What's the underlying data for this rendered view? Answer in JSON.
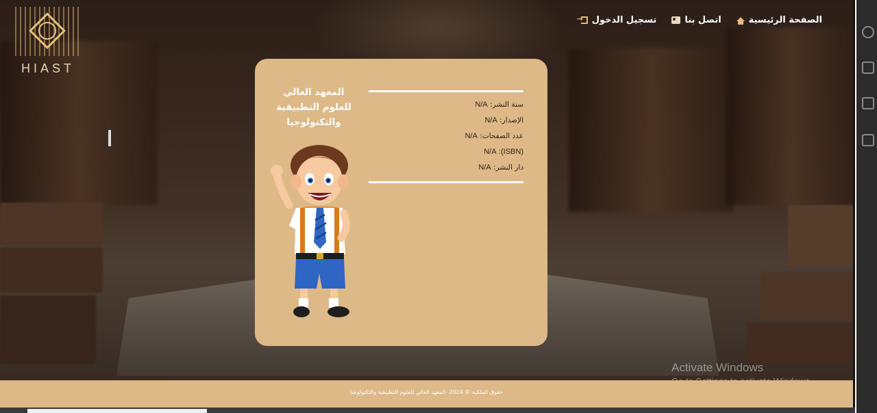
{
  "logo": {
    "text": "HIAST"
  },
  "nav": {
    "login": "تسجيل الدخول",
    "contact": "اتصل بنا",
    "home": "الصفحة الرئيسية"
  },
  "card": {
    "institute_name": "المعهد العالي للعلوم التطبيقية والتكنولوجيا",
    "details": [
      {
        "label": "سنة النشر:",
        "value": "N/A"
      },
      {
        "label": "الإصدار:",
        "value": "N/A"
      },
      {
        "label": "عدد الصفحات:",
        "value": "N/A"
      },
      {
        "label": "(ISBN):",
        "value": "N/A"
      },
      {
        "label": "دار النشر:",
        "value": "N/A"
      }
    ]
  },
  "footer": {
    "text": "حقوق الملكية © 2024- المعهد العالي للعلوم التطبيقية والتكنولوجيا"
  },
  "watermark": {
    "line1": "Activate Windows",
    "line2": "Go to Settings to activate Windows."
  },
  "colors": {
    "card_bg": "#ddb987",
    "footer_bg": "#ddb987",
    "accent": "#e8b97a"
  }
}
